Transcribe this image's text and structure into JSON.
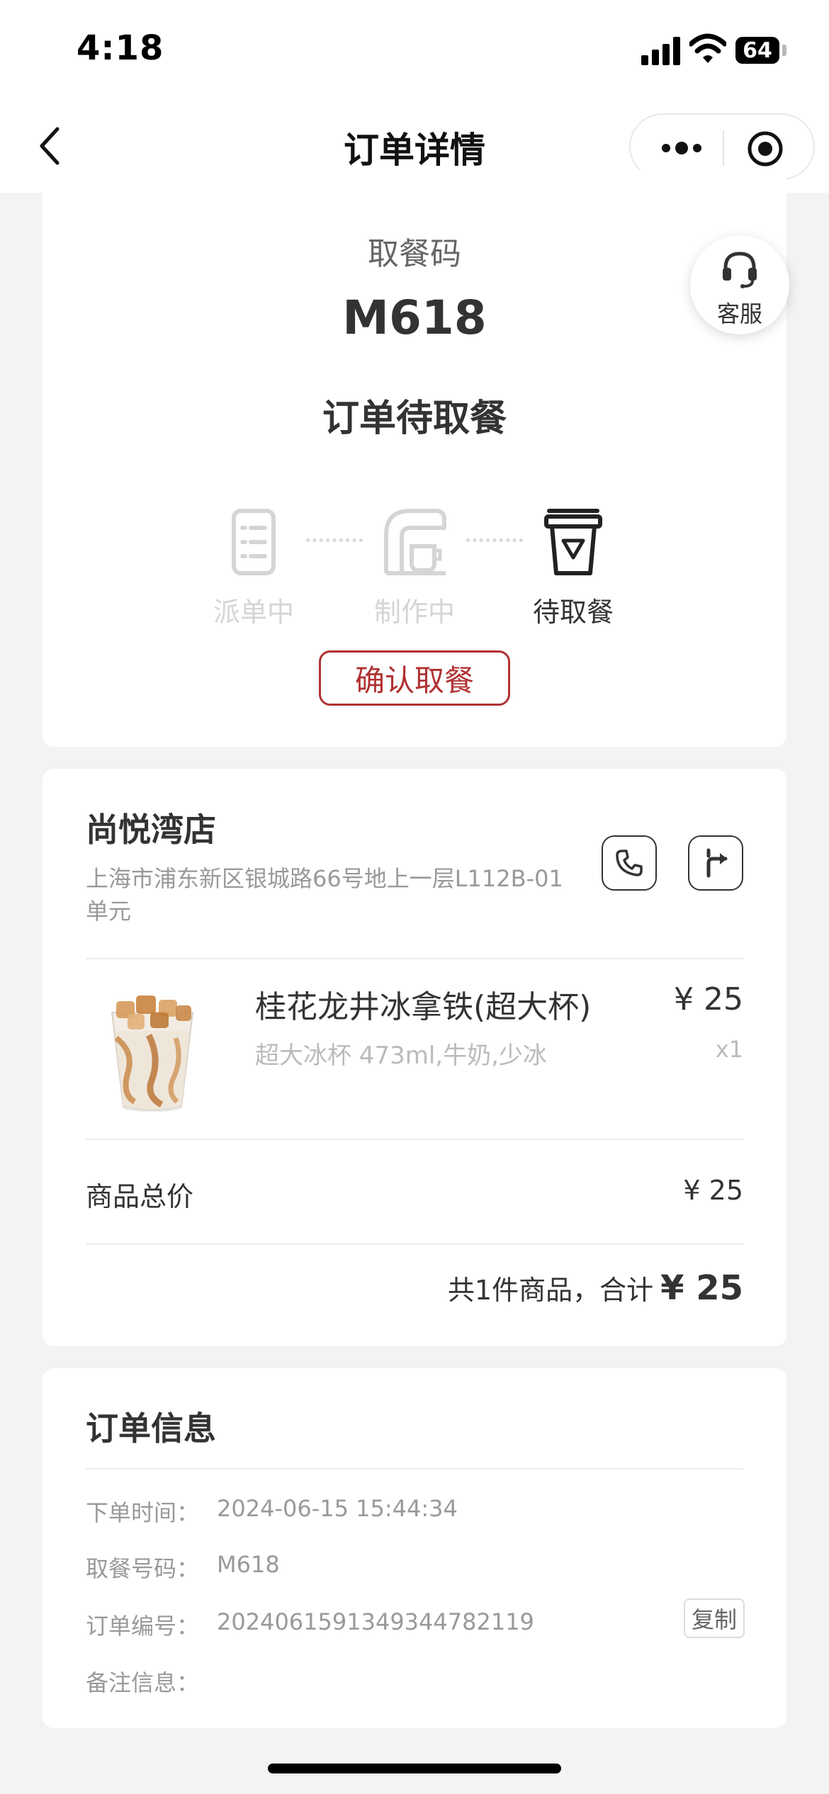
{
  "status_bar": {
    "time": "4:18",
    "battery": "64"
  },
  "nav": {
    "title": "订单详情"
  },
  "pickup": {
    "label": "取餐码",
    "code": "M618",
    "status": "订单待取餐",
    "customer_service": "客服",
    "steps": [
      {
        "label": "派单中",
        "state": "done",
        "icon": "clipboard-icon"
      },
      {
        "label": "制作中",
        "state": "done",
        "icon": "coffee-machine-icon"
      },
      {
        "label": "待取餐",
        "state": "current",
        "icon": "cup-icon"
      }
    ],
    "confirm_button": "确认取餐"
  },
  "store": {
    "name": "尚悦湾店",
    "address": "上海市浦东新区银城路66号地上一层L112B-01单元"
  },
  "product": {
    "name": "桂花龙井冰拿铁(超大杯)",
    "spec": "超大冰杯 473ml,牛奶,少冰",
    "price": "¥ 25",
    "qty": "x1"
  },
  "summary": {
    "subtotal_label": "商品总价",
    "subtotal_value": "¥ 25",
    "total_prefix": "共1件商品，合计",
    "total_value": "¥ 25"
  },
  "order_info": {
    "title": "订单信息",
    "rows": [
      {
        "key": "下单时间：",
        "value": "2024-06-15 15:44:34"
      },
      {
        "key": "取餐号码：",
        "value": "M618"
      },
      {
        "key": "订单编号：",
        "value": "20240615913493447821​19"
      },
      {
        "key": "备注信息：",
        "value": ""
      }
    ],
    "copy_button": "复制"
  },
  "colors": {
    "accent": "#b03232",
    "muted": "#999999",
    "inactive": "#d5d5d5"
  }
}
